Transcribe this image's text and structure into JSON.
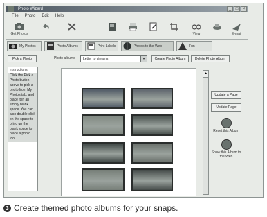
{
  "window": {
    "title": "Photo Wizard"
  },
  "menu": [
    "File",
    "Photo",
    "Edit",
    "Help"
  ],
  "toolbar": [
    {
      "label": "Get Photos",
      "icon": "camera-icon"
    },
    {
      "label": "",
      "icon": "undo-icon"
    },
    {
      "label": "",
      "icon": "delete-icon"
    },
    {
      "label": "",
      "icon": "album-icon"
    },
    {
      "label": "",
      "icon": "print-icon"
    },
    {
      "label": "",
      "icon": "edit-icon"
    },
    {
      "label": "",
      "icon": "crop-icon"
    },
    {
      "label": "View",
      "icon": "view-icon"
    },
    {
      "label": "",
      "icon": "email-icon"
    },
    {
      "label": "E-mail",
      "icon": "send-icon"
    }
  ],
  "tabs": [
    "My Photos",
    "Photo Albums",
    "Print Labels",
    "Photos to the Web",
    "Fun"
  ],
  "actions": {
    "create_button": "Pick a Photo",
    "album_label": "Photo albums",
    "album_value": "Letter to dreams",
    "new_album_button": "Create Photo Album",
    "delete_album_button": "Delete Photo Album"
  },
  "instructions": {
    "heading": "Instructions",
    "text": "Click the Pick a Photo button above to pick a photo from My Photos tab, and place it in an empty blank space. You can also double-click on the space to bring up the blank space to place a photo too."
  },
  "right_panel": {
    "update_page": "Update a Page",
    "update_page2": "Update Page",
    "tool1_label": "Reset this Album",
    "tool2_label": "Show this Album to the Web"
  },
  "photo_colors": [
    "#505a66",
    "#5f666e",
    "#828a83",
    "#4a524f",
    "#3f4745",
    "#6b716c",
    "#777f78",
    "#454b49"
  ],
  "caption": {
    "number": "3",
    "text": "Create themed photo albums for your snaps."
  }
}
